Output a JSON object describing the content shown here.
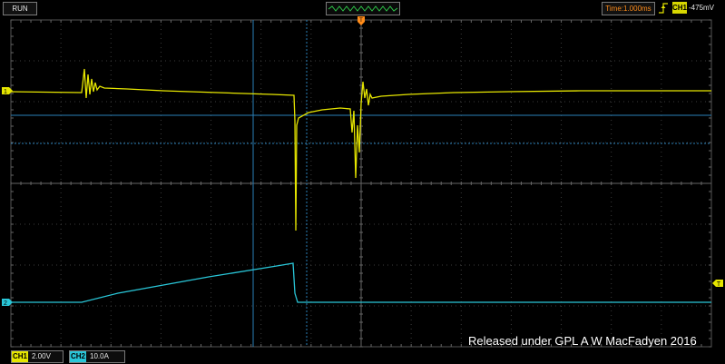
{
  "status": {
    "run_label": "RUN"
  },
  "timebase": {
    "label": "Time:1.000ms"
  },
  "trigger": {
    "channel": "CH1",
    "level": "-475mV"
  },
  "channels": {
    "ch1": {
      "name": "CH1",
      "scale": "2.00V",
      "marker": "1",
      "color": "#e6e600"
    },
    "ch2": {
      "name": "CH2",
      "scale": "10.0A",
      "marker": "2",
      "color": "#29c6d8"
    }
  },
  "markers": {
    "trigger_level": "T"
  },
  "credit": "Released under GPL  A W MacFadyen 2016",
  "colors": {
    "grid": "#444444",
    "cursor": "#2a7fb8",
    "background": "#000000"
  }
}
